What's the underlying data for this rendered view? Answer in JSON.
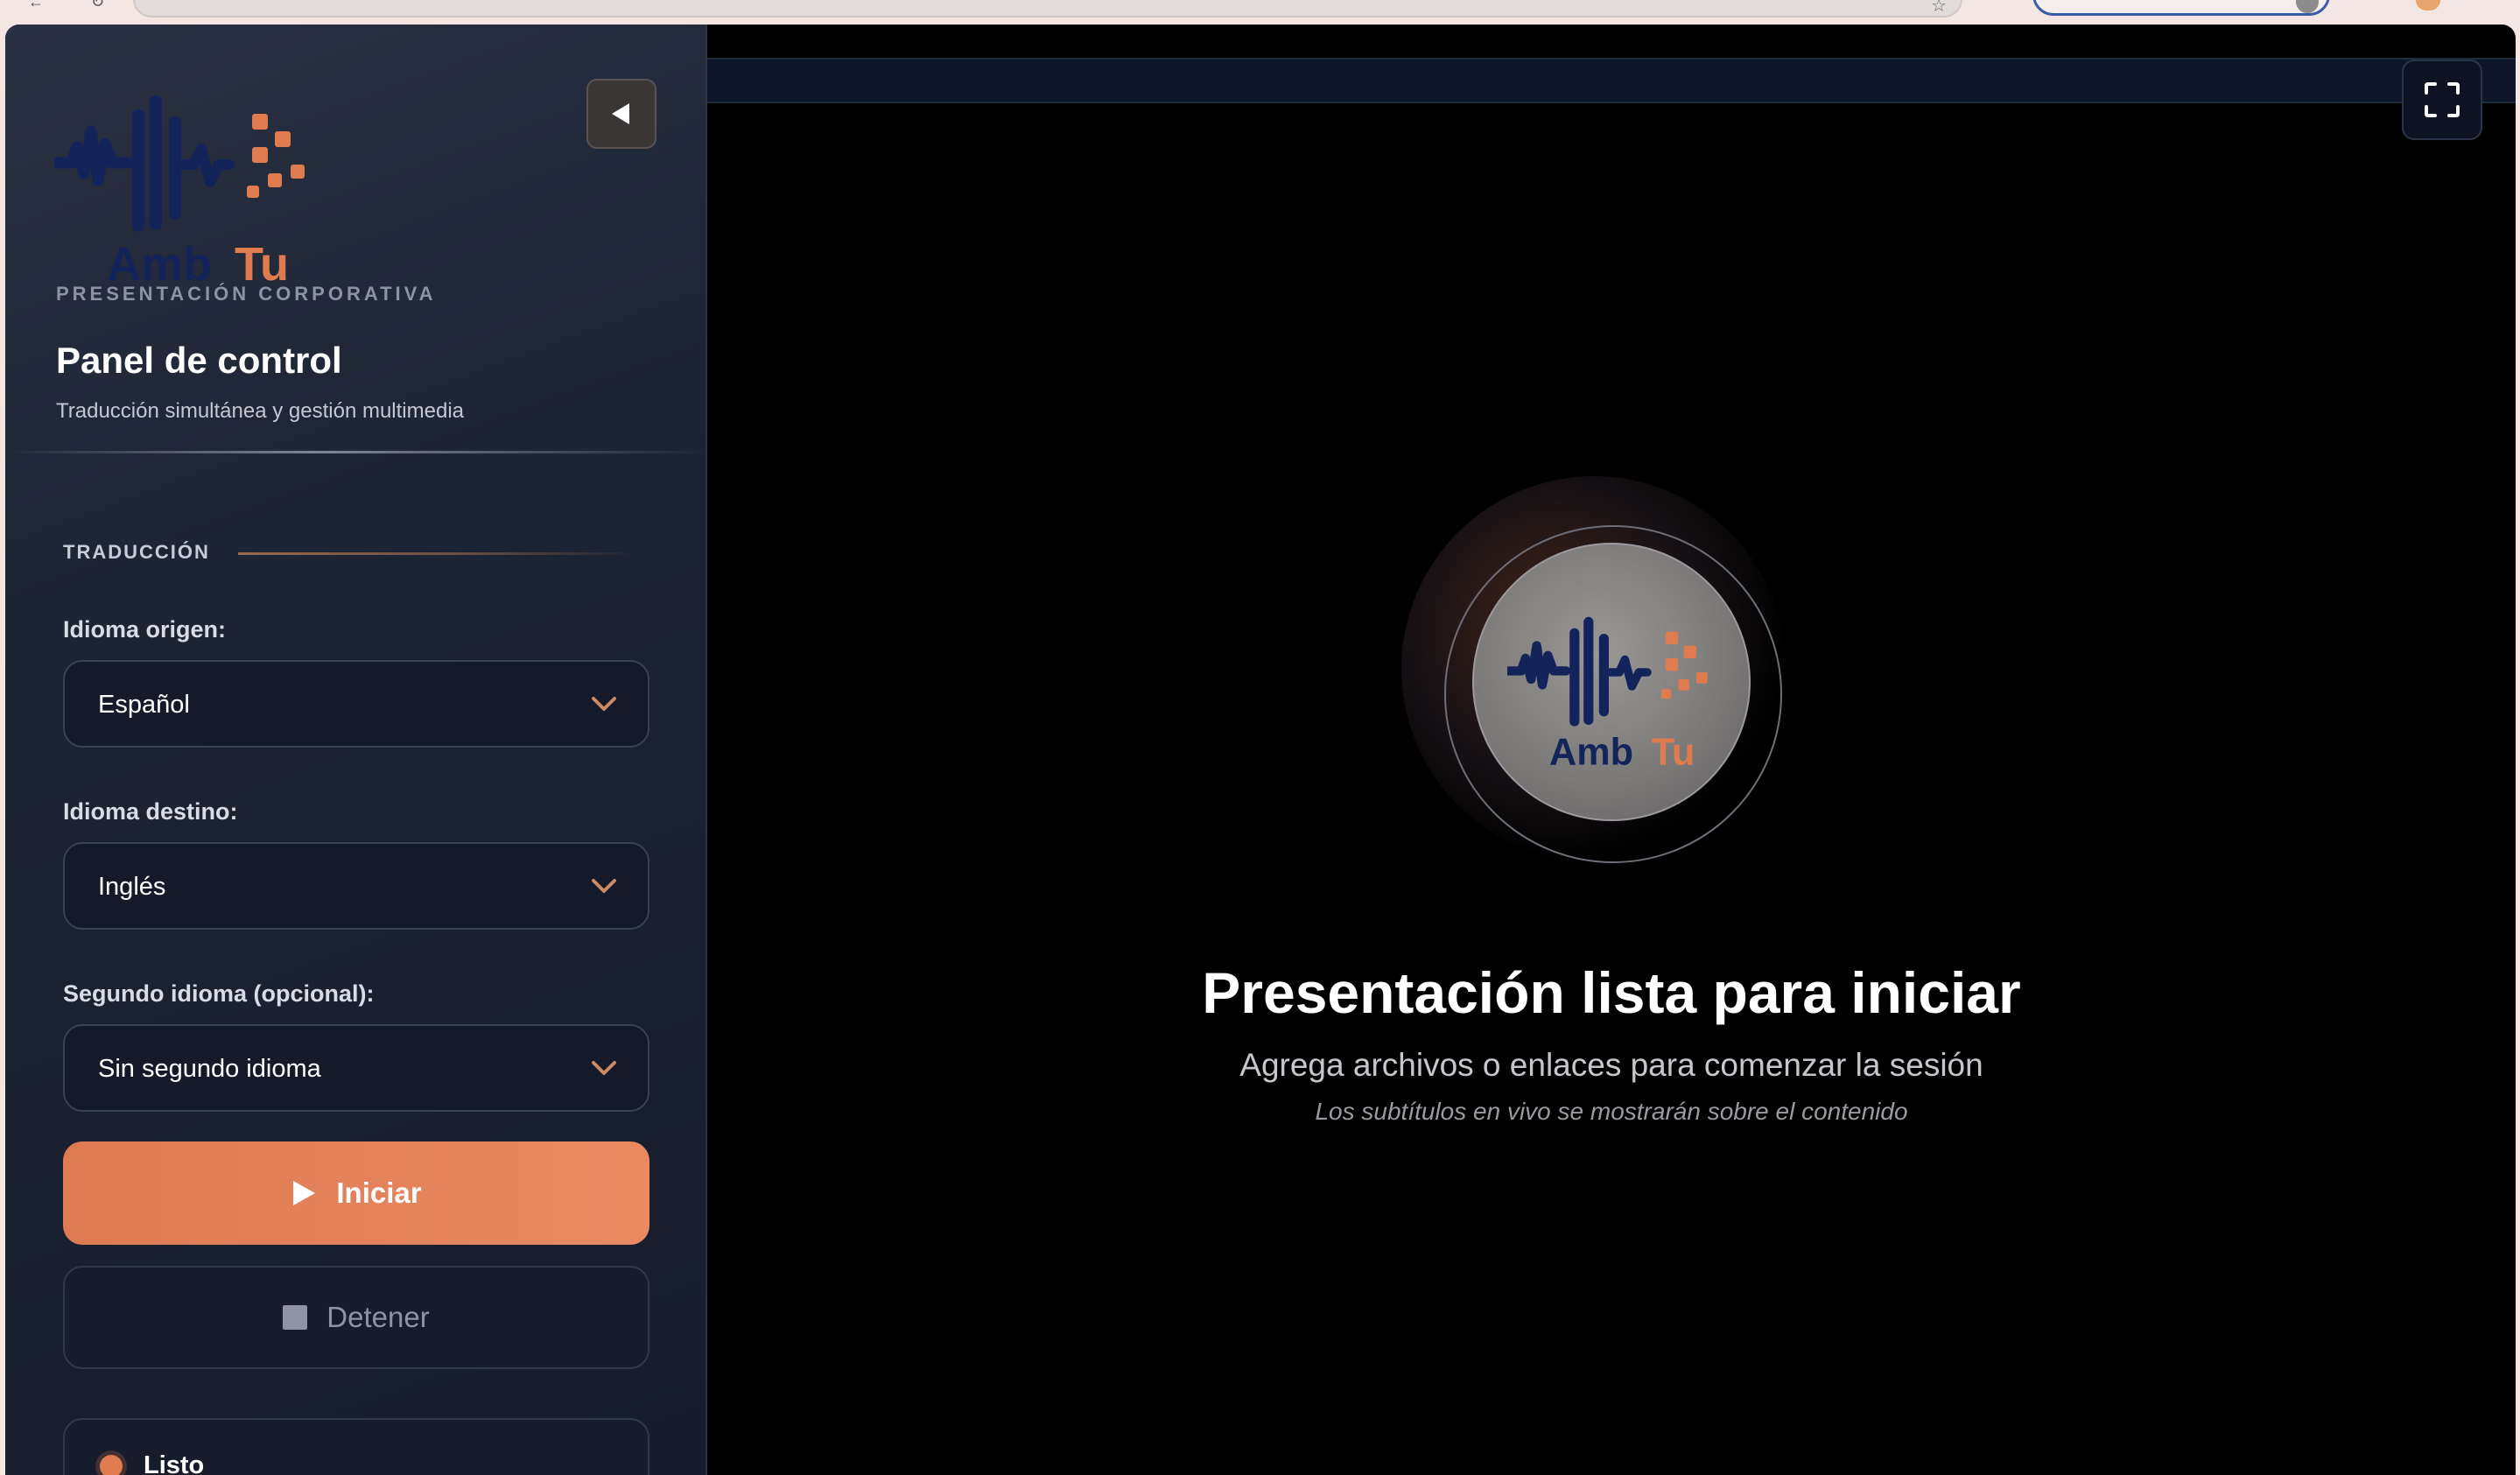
{
  "brand": {
    "name_part1": "Amb",
    "name_part2": "Tu",
    "subtitle": "PRESENTACIÓN CORPORATIVA",
    "colors": {
      "navy": "#13245a",
      "orange": "#e07b4f"
    }
  },
  "panel": {
    "title": "Panel de control",
    "description": "Traducción simultánea y gestión multimedia"
  },
  "translation": {
    "section_label": "TRADUCCIÓN",
    "source_label": "Idioma origen:",
    "source_value": "Español",
    "target_label": "Idioma destino:",
    "target_value": "Inglés",
    "second_label": "Segundo idioma (opcional):",
    "second_value": "Sin segundo idioma"
  },
  "controls": {
    "start_label": "Iniciar",
    "stop_label": "Detener",
    "status_text": "Listo"
  },
  "main": {
    "title": "Presentación lista para iniciar",
    "subtitle": "Agrega archivos o enlaces para comenzar la sesión",
    "note": "Los subtítulos en vivo se mostrarán sobre el contenido"
  },
  "icons": {
    "collapse": "triangle-left-icon",
    "fullscreen": "fullscreen-icon",
    "start": "play-icon",
    "stop": "stop-square-icon",
    "dropdown": "chevron-down-icon"
  }
}
